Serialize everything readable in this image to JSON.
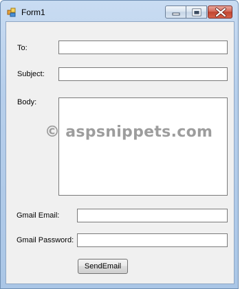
{
  "window": {
    "title": "Form1",
    "icon": "winforms-app-icon"
  },
  "title_controls": [
    "minimize-icon",
    "maximize-icon",
    "close-icon"
  ],
  "form": {
    "to_label": "To:",
    "to_value": "",
    "subject_label": "Subject:",
    "subject_value": "",
    "body_label": "Body:",
    "body_value": "",
    "gmail_email_label": "Gmail Email:",
    "gmail_email_value": "",
    "gmail_password_label": "Gmail Password:",
    "gmail_password_value": "",
    "send_button_label": "SendEmail"
  },
  "watermark": "© aspsnippets.com",
  "colors": {
    "client_background": "#f0f0f0",
    "close_button": "#c0442f",
    "titlebar": "#b7cfeb"
  }
}
